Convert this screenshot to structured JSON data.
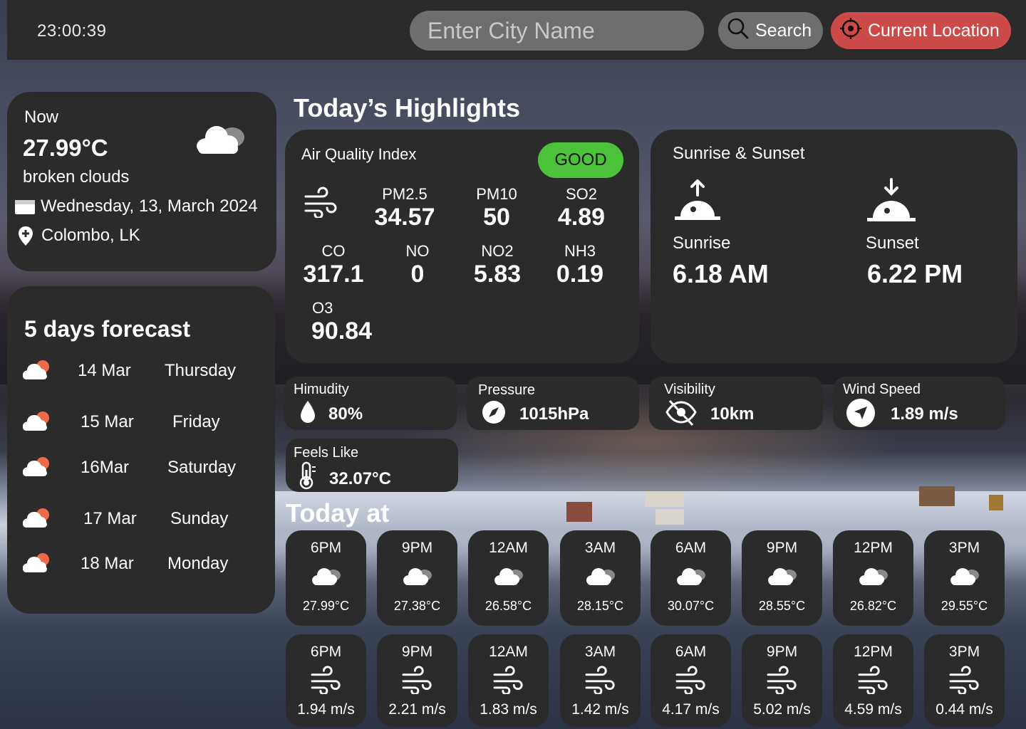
{
  "header": {
    "time": "23:00:39",
    "search_placeholder": "Enter City Name",
    "search_label": "Search",
    "location_label": "Current Location"
  },
  "current": {
    "label": "Now",
    "temperature": "27.99°C",
    "description": "broken clouds",
    "date": "Wednesday, 13, March 2024",
    "location": "Colombo, LK"
  },
  "forecast": {
    "title": "5 days forecast",
    "days": [
      {
        "date": "14 Mar",
        "day": "Thursday"
      },
      {
        "date": "15 Mar",
        "day": "Friday"
      },
      {
        "date": "16Mar",
        "day": "Saturday"
      },
      {
        "date": "17 Mar",
        "day": "Sunday"
      },
      {
        "date": "18 Mar",
        "day": "Monday"
      }
    ]
  },
  "highlights": {
    "title": "Today’s Highlights",
    "aqi": {
      "title": "Air Quality Index",
      "badge": "GOOD",
      "badge_color": "#4cc13a",
      "items": [
        {
          "label": "PM2.5",
          "value": "34.57"
        },
        {
          "label": "PM10",
          "value": "50"
        },
        {
          "label": "SO2",
          "value": "4.89"
        },
        {
          "label": "CO",
          "value": "317.1"
        },
        {
          "label": "NO",
          "value": "0"
        },
        {
          "label": "NO2",
          "value": "5.83"
        },
        {
          "label": "NH3",
          "value": "0.19"
        },
        {
          "label": "O3",
          "value": "90.84"
        }
      ]
    },
    "sun": {
      "title": "Sunrise & Sunset",
      "sunrise_label": "Sunrise",
      "sunrise_time": "6.18 AM",
      "sunset_label": "Sunset",
      "sunset_time": "6.22 PM"
    },
    "humidity": {
      "label": "Himudity",
      "value": "80%"
    },
    "pressure": {
      "label": "Pressure",
      "value": "1015hPa"
    },
    "visibility": {
      "label": "Visibility",
      "value": "10km"
    },
    "wind": {
      "label": "Wind Speed",
      "value": "1.89 m/s"
    },
    "feels_like": {
      "label": "Feels Like",
      "value": "32.07°C"
    }
  },
  "today": {
    "title": "Today at",
    "temps": [
      {
        "time": "6PM",
        "value": "27.99°C"
      },
      {
        "time": "9PM",
        "value": "27.38°C"
      },
      {
        "time": "12AM",
        "value": "26.58°C"
      },
      {
        "time": "3AM",
        "value": "28.15°C"
      },
      {
        "time": "6AM",
        "value": "30.07°C"
      },
      {
        "time": "9PM",
        "value": "28.55°C"
      },
      {
        "time": "12PM",
        "value": "26.82°C"
      },
      {
        "time": "3PM",
        "value": "29.55°C"
      }
    ],
    "winds": [
      {
        "time": "6PM",
        "value": "1.94 m/s"
      },
      {
        "time": "9PM",
        "value": "2.21 m/s"
      },
      {
        "time": "12AM",
        "value": "1.83 m/s"
      },
      {
        "time": "3AM",
        "value": "1.42 m/s"
      },
      {
        "time": "6AM",
        "value": "4.17 m/s"
      },
      {
        "time": "9PM",
        "value": "5.02 m/s"
      },
      {
        "time": "12PM",
        "value": "4.59 m/s"
      },
      {
        "time": "3PM",
        "value": "0.44 m/s"
      }
    ]
  },
  "colors": {
    "card": "#2b2b2b",
    "accent_red": "#cc4a48",
    "input_gray": "#6e6e6e",
    "good_green": "#4cc13a"
  }
}
